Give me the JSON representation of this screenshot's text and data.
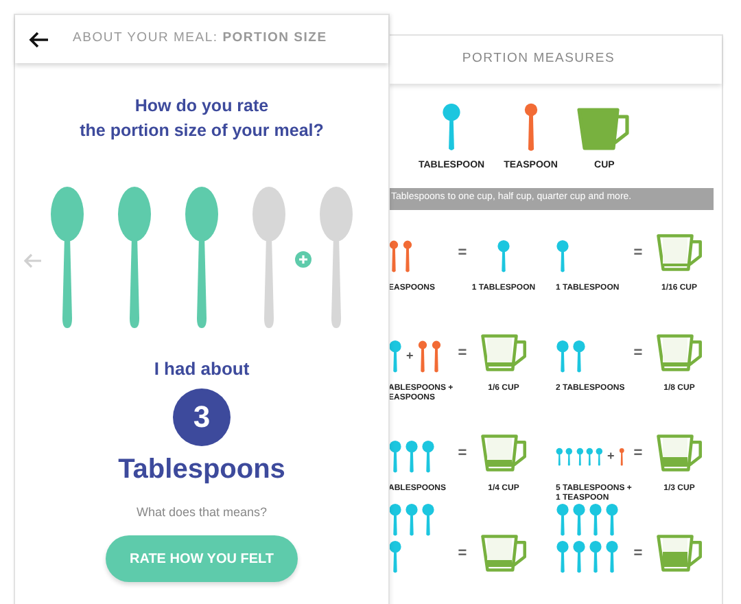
{
  "header": {
    "title": "ABOUT YOUR MEAL: **PORTION SIZE**"
  },
  "question": "How do you rate\nthe portion size of your meal?",
  "spoons": [
    {
      "filled": true
    },
    {
      "filled": true
    },
    {
      "filled": true
    },
    {
      "filled": false
    },
    {
      "filled": false
    }
  ],
  "amount_prefix": "I had about",
  "amount": "3",
  "unit": "Tablespoons",
  "help_link": "What does that means?",
  "button": "RATE HOW YOU FELT",
  "measures": {
    "title": "PORTION MEASURES",
    "legend": [
      {
        "kind": "tablespoon",
        "label": "TABLESPOON"
      },
      {
        "kind": "teaspoon",
        "label": "TEASPOON"
      },
      {
        "kind": "cup",
        "label": "CUP"
      }
    ],
    "banner": "Tablespoons to one cup, half cup, quarter cup and more.",
    "conversions": [
      {
        "lhs": [
          {
            "kind": "teaspoon"
          },
          {
            "kind": "teaspoon"
          }
        ],
        "equals": "=",
        "rhs": {
          "kind": "tablespoon"
        },
        "lhs_label": "EASPOONS",
        "rhs_label": "1 TABLESPOON"
      },
      {
        "lhs": [
          {
            "kind": "tablespoon"
          }
        ],
        "equals": "=",
        "rhs": {
          "kind": "cup",
          "level": 0.1
        },
        "lhs_label": "1 TABLESPOON",
        "rhs_label": "1/16 CUP"
      },
      {
        "lhs": [
          {
            "kind": "tablespoon"
          },
          {
            "kind": "plus",
            "text": "+"
          },
          {
            "kind": "teaspoon"
          },
          {
            "kind": "teaspoon"
          }
        ],
        "equals": "=",
        "rhs": {
          "kind": "cup",
          "level": 0.15
        },
        "lhs_label": "ABLESPOONS +\nEASPOONS",
        "rhs_label": "1/6 CUP"
      },
      {
        "lhs": [
          {
            "kind": "tablespoon"
          },
          {
            "kind": "tablespoon"
          }
        ],
        "equals": "=",
        "rhs": {
          "kind": "cup",
          "level": 0.12
        },
        "lhs_label": "2 TABLESPOONS",
        "rhs_label": "1/8 CUP"
      },
      {
        "lhs": [
          {
            "kind": "tablespoon"
          },
          {
            "kind": "tablespoon"
          },
          {
            "kind": "tablespoon"
          }
        ],
        "equals": "=",
        "rhs": {
          "kind": "cup",
          "level": 0.25
        },
        "lhs_label": "ABLESPOONS",
        "rhs_label": "1/4 CUP"
      },
      {
        "lhs": [
          {
            "kind": "tablespoon"
          },
          {
            "kind": "tablespoon"
          },
          {
            "kind": "tablespoon"
          },
          {
            "kind": "tablespoon"
          },
          {
            "kind": "tablespoon"
          },
          {
            "kind": "plus",
            "text": "+"
          },
          {
            "kind": "teaspoon"
          }
        ],
        "equals": "=",
        "rhs": {
          "kind": "cup",
          "level": 0.33
        },
        "lhs_label": "5 TABLESPOONS +\n1 TEASPOON",
        "rhs_label": "1/3 CUP"
      },
      {
        "lhs": [
          {
            "kind": "tablespoon"
          },
          {
            "kind": "tablespoon"
          },
          {
            "kind": "tablespoon"
          },
          {
            "kind": "break"
          },
          {
            "kind": "tablespoon"
          }
        ],
        "equals": "=",
        "rhs": {
          "kind": "cup",
          "level": 0.25
        }
      },
      {
        "lhs": [
          {
            "kind": "tablespoon"
          },
          {
            "kind": "tablespoon"
          },
          {
            "kind": "tablespoon"
          },
          {
            "kind": "tablespoon"
          },
          {
            "kind": "break"
          },
          {
            "kind": "tablespoon"
          },
          {
            "kind": "tablespoon"
          },
          {
            "kind": "tablespoon"
          },
          {
            "kind": "tablespoon"
          }
        ],
        "equals": "=",
        "rhs": {
          "kind": "cup",
          "level": 0.5
        }
      }
    ]
  }
}
